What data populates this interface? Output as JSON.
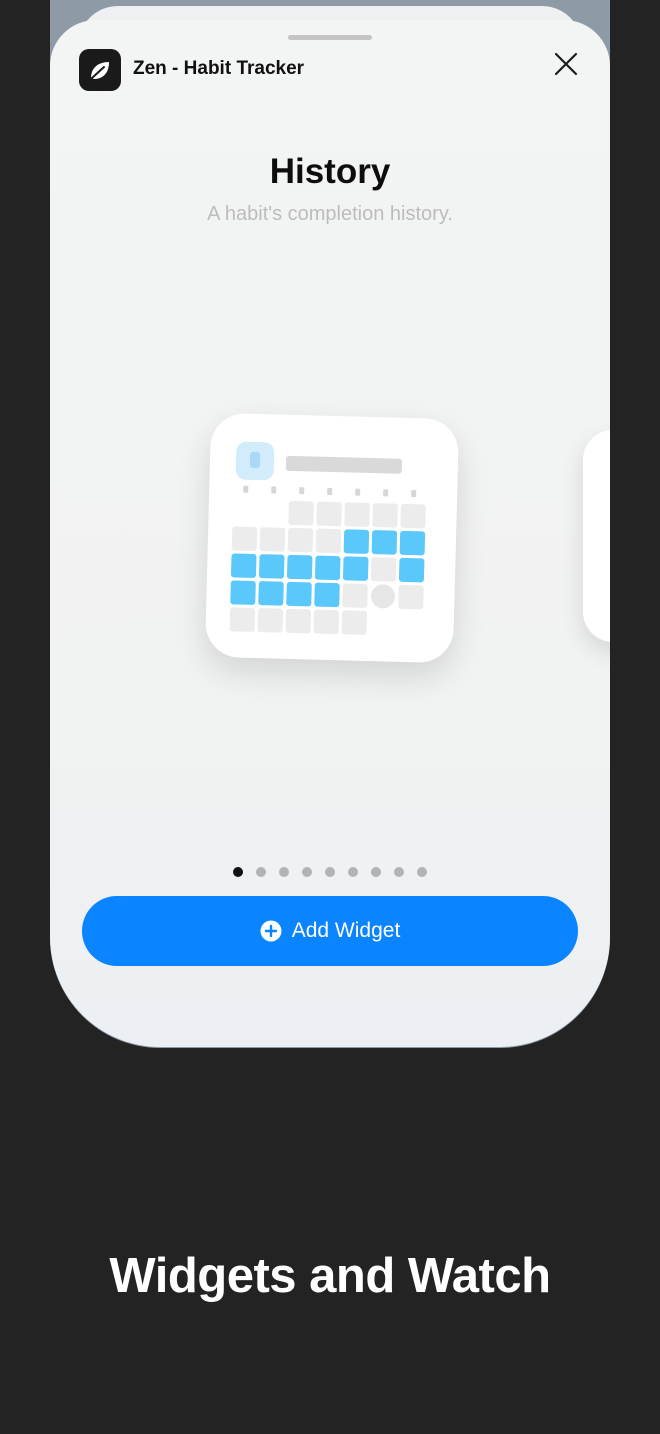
{
  "sheet": {
    "app_name": "Zen - Habit Tracker",
    "app_icon": "leaf-icon",
    "close_icon": "close-icon",
    "title": "History",
    "subtitle": "A habit's completion history.",
    "page_indicator": {
      "total": 9,
      "current": 1
    },
    "add_button_label": "Add Widget",
    "add_button_icon": "plus-circle-icon"
  },
  "widget_preview": {
    "grid_columns": 7,
    "grid_rows": 5,
    "cells": [
      "empty",
      "empty",
      "gray",
      "gray",
      "gray",
      "gray",
      "gray",
      "gray",
      "gray",
      "gray",
      "gray",
      "blue",
      "blue",
      "blue",
      "blue",
      "blue",
      "blue",
      "blue",
      "blue",
      "gray",
      "blue",
      "blue",
      "blue",
      "blue",
      "blue",
      "gray",
      "circle",
      "gray",
      "gray",
      "gray",
      "gray",
      "gray",
      "gray",
      "empty",
      "empty"
    ]
  },
  "colors": {
    "accent": "#0a84ff",
    "completed_cell": "#5ac8fa",
    "empty_cell": "#ececed",
    "background": "#232323"
  },
  "caption": "Widgets and Watch"
}
